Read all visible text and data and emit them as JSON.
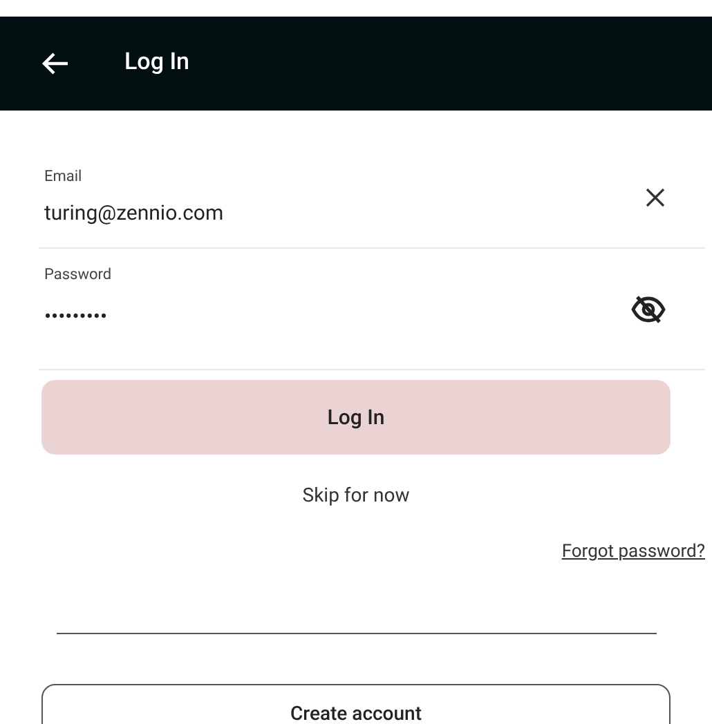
{
  "header": {
    "title": "Log In"
  },
  "fields": [
    {
      "kind": "email",
      "label": "Email",
      "value": "turing@zennio.com"
    },
    {
      "kind": "password",
      "label": "Password",
      "value": "•••••••••"
    }
  ],
  "login_button": {
    "label": "Log In",
    "disabled": true
  },
  "skip_link": "Skip for now",
  "forgot_link": "Forgot password?",
  "create_button": "Create account"
}
